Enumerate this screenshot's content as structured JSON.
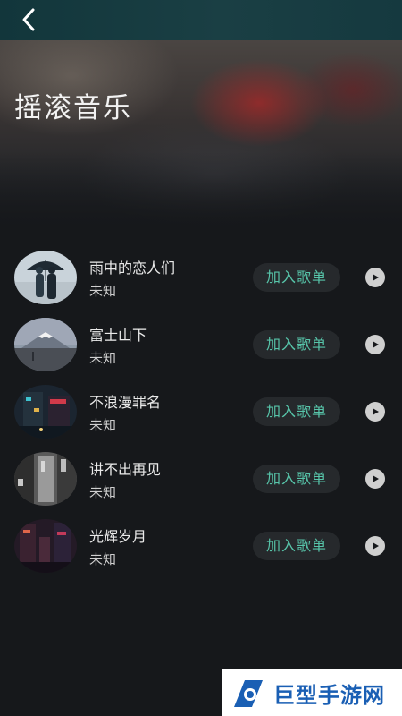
{
  "header": {
    "back_icon": "chevron-left-icon",
    "background_color": "#15393f"
  },
  "hero": {
    "title": "摇滚音乐"
  },
  "songs": [
    {
      "title": "雨中的恋人们",
      "artist": "未知",
      "add_label": "加入歌单",
      "cover": "couple-umbrella"
    },
    {
      "title": "富士山下",
      "artist": "未知",
      "add_label": "加入歌单",
      "cover": "mount-fuji"
    },
    {
      "title": "不浪漫罪名",
      "artist": "未知",
      "add_label": "加入歌单",
      "cover": "neon-street"
    },
    {
      "title": "讲不出再见",
      "artist": "未知",
      "add_label": "加入歌单",
      "cover": "bw-alley"
    },
    {
      "title": "光辉岁月",
      "artist": "未知",
      "add_label": "加入歌单",
      "cover": "night-city"
    }
  ],
  "colors": {
    "accent": "#57c4a9",
    "button_bg": "#26292c",
    "page_bg": "#16181b"
  },
  "watermark": {
    "text": "巨型手游网"
  }
}
